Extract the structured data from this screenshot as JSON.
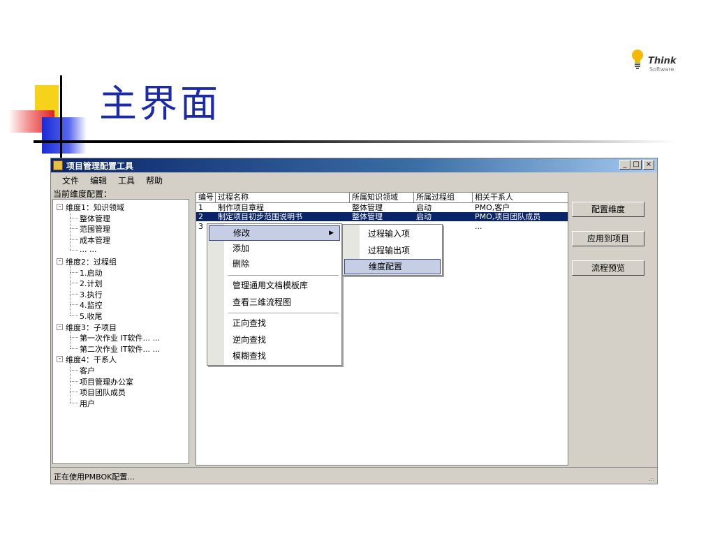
{
  "slide": {
    "title": "主界面",
    "logo_text": "Think",
    "logo_subtext": "Software"
  },
  "window": {
    "title": "项目管理配置工具",
    "buttons": {
      "minimize": "_",
      "maximize": "□",
      "close": "×"
    }
  },
  "menu": [
    "文件",
    "编辑",
    "工具",
    "帮助"
  ],
  "tree": {
    "header": "当前维度配置：",
    "nodes": [
      {
        "label": "维度1：知识领域",
        "level": 0,
        "expander": "-"
      },
      {
        "label": "整体管理",
        "level": 1
      },
      {
        "label": "范围管理",
        "level": 1
      },
      {
        "label": "成本管理",
        "level": 1
      },
      {
        "label": "... ...",
        "level": 1
      },
      {
        "label": "维度2：过程组",
        "level": 0,
        "expander": "-"
      },
      {
        "label": "1.启动",
        "level": 1
      },
      {
        "label": "2.计划",
        "level": 1
      },
      {
        "label": "3.执行",
        "level": 1
      },
      {
        "label": "4.监控",
        "level": 1
      },
      {
        "label": "5.收尾",
        "level": 1
      },
      {
        "label": "维度3：子项目",
        "level": 0,
        "expander": "-"
      },
      {
        "label": "第一次作业 IT软件... ...",
        "level": 1
      },
      {
        "label": "第二次作业 IT软件... ...",
        "level": 1
      },
      {
        "label": "维度4：干系人",
        "level": 0,
        "expander": "-"
      },
      {
        "label": "客户",
        "level": 1
      },
      {
        "label": "项目管理办公室",
        "level": 1
      },
      {
        "label": "项目团队成员",
        "level": 1
      },
      {
        "label": "用户",
        "level": 1
      }
    ]
  },
  "grid": {
    "columns": [
      "编号",
      "过程名称",
      "所属知识领域",
      "所属过程组",
      "相关干系人"
    ],
    "rows": [
      {
        "cells": [
          "1",
          "制作项目章程",
          "整体管理",
          "启动",
          "PMO,客户"
        ],
        "selected": false
      },
      {
        "cells": [
          "2",
          "制定项目初步范围说明书",
          "整体管理",
          "启动",
          "PMO,项目团队成员"
        ],
        "selected": true
      },
      {
        "cells": [
          "3",
          "",
          "",
          "",
          "..."
        ],
        "selected": false
      }
    ]
  },
  "side_buttons": [
    "配置维度",
    "应用到项目",
    "流程预览"
  ],
  "context_menu": {
    "items": [
      "修改",
      "添加",
      "删除",
      "管理通用文档模板库",
      "查看三维流程图",
      "正向查找",
      "逆向查找",
      "模糊查找"
    ],
    "highlighted": "修改",
    "submenu": [
      "过程输入项",
      "过程输出项",
      "维度配置"
    ],
    "submenu_highlighted": "维度配置"
  },
  "status": {
    "text": "正在使用PMBOK配置..."
  },
  "colors": {
    "title_blue": "#1a2aa8",
    "selection": "#0a246a",
    "window_bg": "#d4d0c8"
  }
}
